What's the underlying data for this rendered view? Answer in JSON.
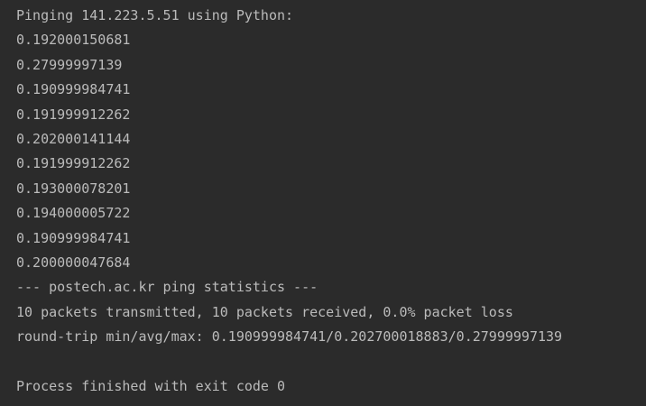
{
  "console": {
    "header": "Pinging 141.223.5.51 using Python:",
    "rtts": [
      "0.192000150681",
      "0.27999997139",
      "0.190999984741",
      "0.191999912262",
      "0.202000141144",
      "0.191999912262",
      "0.193000078201",
      "0.194000005722",
      "0.190999984741",
      "0.200000047684"
    ],
    "stats_title": "--- postech.ac.kr ping statistics ---",
    "packets_summary": "10 packets transmitted, 10 packets received, 0.0% packet loss",
    "round_trip": "round-trip min/avg/max: 0.190999984741/0.202700018883/0.27999997139",
    "exit_message": "Process finished with exit code 0"
  },
  "colors": {
    "background": "#2b2b2b",
    "text": "#bbbbbb"
  }
}
